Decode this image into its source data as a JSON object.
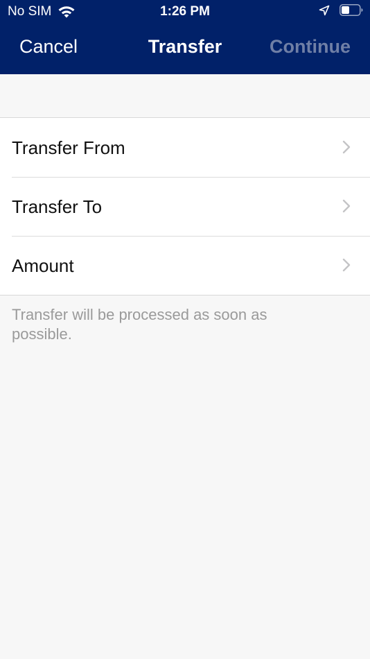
{
  "status_bar": {
    "carrier": "No SIM",
    "time": "1:26 PM",
    "icons": [
      "wifi-icon",
      "location-arrow-icon",
      "battery-icon"
    ]
  },
  "nav": {
    "cancel_label": "Cancel",
    "title": "Transfer",
    "continue_label": "Continue"
  },
  "rows": [
    {
      "label": "Transfer From",
      "icon": "chevron-right-icon"
    },
    {
      "label": "Transfer To",
      "icon": "chevron-right-icon"
    },
    {
      "label": "Amount",
      "icon": "chevron-right-icon"
    }
  ],
  "footnote": "Transfer will be processed as soon as possible.",
  "colors": {
    "header_bg": "#012169",
    "continue_disabled": "#6f7fa6",
    "page_bg": "#f7f7f7",
    "footnote_text": "#9a9a9a"
  }
}
